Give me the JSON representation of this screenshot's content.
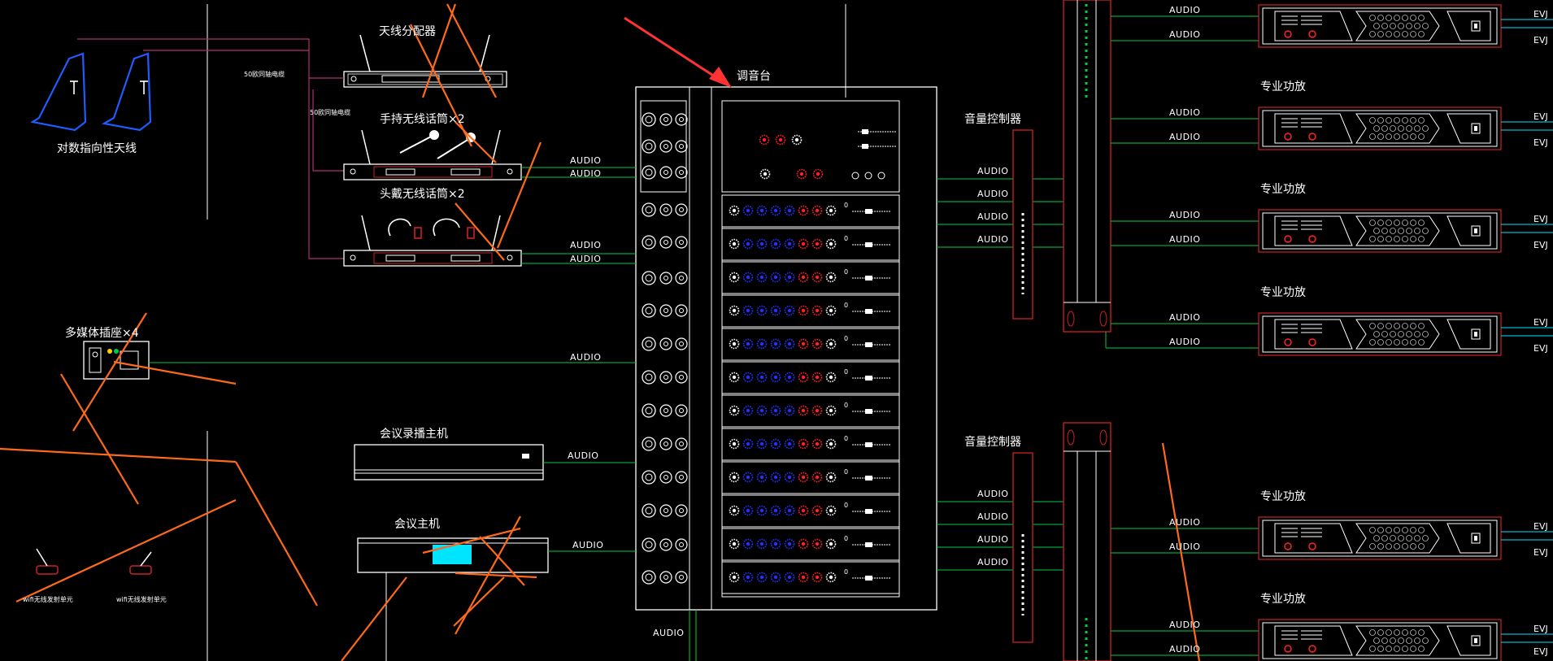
{
  "labels": {
    "antenna": "对数指向性天线",
    "splitter": "天线分配器",
    "handheld": "手持无线话筒×2",
    "headset": "头戴无线话筒×2",
    "multimedia": "多媒体插座×4",
    "recorder": "会议录播主机",
    "conference": "会议主机",
    "mixer": "调音台",
    "volume1": "音量控制器",
    "volume2": "音量控制器",
    "amp": "专业功放",
    "cable": "50欧同轴电缆",
    "wifi1": "wifi无线发射单元",
    "wifi2": "wifi无线发射单元",
    "audio": "AUDIO",
    "evj": "EVJ"
  },
  "colors": {
    "background": "#000000",
    "line": "#ffffff",
    "signal": "#00cc44",
    "rack": "#cc2222",
    "cable": "#b03070",
    "knob_blue": "#2233ff",
    "knob_red": "#ff2222",
    "markup": "#ff6a1a",
    "arrow": "#ff3333",
    "cyan": "#00e5ff",
    "antenna": "#1e5cff"
  }
}
